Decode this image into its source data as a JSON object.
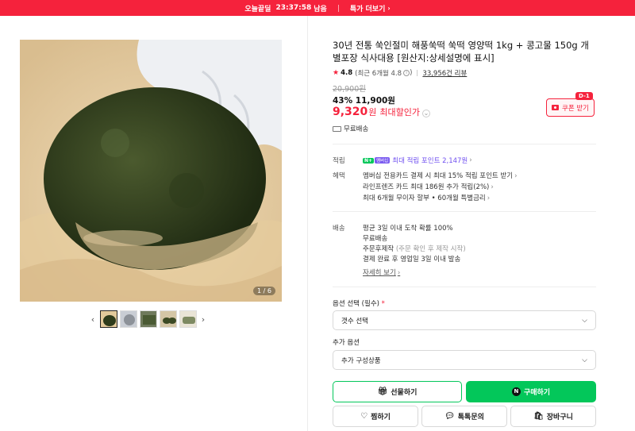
{
  "topbar": {
    "brand": "오늘끝딜",
    "countdown": "23:37:58",
    "countdown_suffix": "남음",
    "more_label": "특가 더보기",
    "bg_color": "#f5223c"
  },
  "gallery": {
    "counter": "1 / 6",
    "prev_icon": "chevron-left-icon",
    "next_icon": "chevron-right-icon",
    "thumbnails_count": 5
  },
  "product": {
    "title": "30년 전통 쑥인절미 해풍쑥떡 쑥떡 영양떡 1kg + 콩고물 150g 개별포장 식사대용 [원산지:상세설명에 표시]",
    "rating": "4.8",
    "rating_note": "(최근 6개월 4.8",
    "rating_note_end": ")",
    "reviews": "33,956건 리뷰",
    "original_price": "20,900원",
    "discount": "43% 11,900원",
    "best_price": "9,320",
    "best_unit": "원",
    "best_label": "최대할인가",
    "coupon_label": "쿠폰 받기",
    "dday": "D-1",
    "shipping_free": "무료배송"
  },
  "benefits": {
    "points_label": "적립",
    "points_text": "최대 적립 포인트 2,147원",
    "npay_badge": "N+",
    "membership_badge": "멤버십",
    "benefit_label": "혜택",
    "benefit_lines": [
      "멤버십 전용카드 결제 시 최대 15% 적립 포인트 받기",
      "라인프렌즈 카드 최대 186원 추가 적립(2%)",
      "최대 6개월 무이자 할부 • 60개월 특별금리"
    ]
  },
  "delivery": {
    "label": "배송",
    "line1": "평균 3일 이내 도착 확률 100%",
    "line2": "무료배송",
    "line3_main": "주문후제작",
    "line3_note": "(주문 확인 후 제작 시작)",
    "line4": "결제 완료 후 영업일 3일 이내 발송",
    "details_link": "자세히 보기"
  },
  "options": {
    "required_label": "옵션 선택 (필수)",
    "required_mark": "*",
    "required_value": "갯수 선택",
    "extra_label": "추가 옵션",
    "extra_value": "추가 구성상품"
  },
  "actions": {
    "gift": "선물하기",
    "buy": "구매하기",
    "wish": "찜하기",
    "talk": "톡톡문의",
    "cart": "장바구니",
    "buy_color": "#03c75a"
  }
}
